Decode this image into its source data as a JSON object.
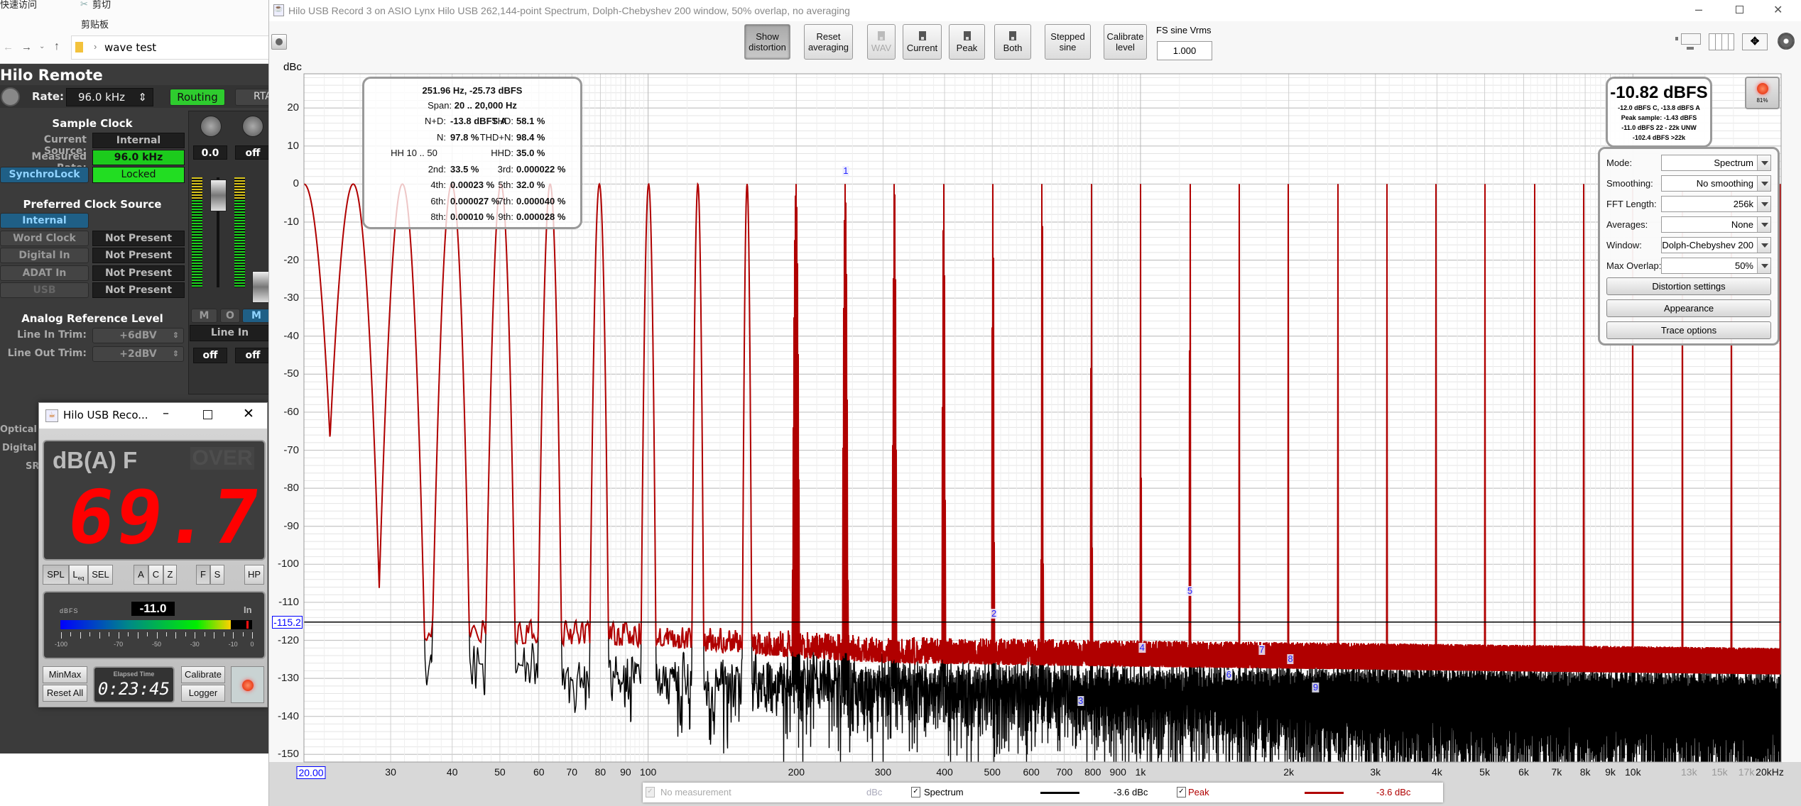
{
  "explorer": {
    "quick_access": "快速访问",
    "cut": "剪切",
    "clipboard": "剪贴板",
    "address": "wave test"
  },
  "hilo_remote": {
    "title": "Hilo Remote",
    "rate_label": "Rate:",
    "rate_value": "96.0 kHz",
    "routing": "Routing",
    "rta": "RTA",
    "sample_clock": {
      "heading": "Sample Clock",
      "current_source_label": "Current Source:",
      "current_source_value": "Internal",
      "measured_rate_label": "Measured Rate:",
      "measured_rate_value": "96.0 kHz",
      "synchrolock_label": "SynchroLock",
      "synchrolock_value": "Locked"
    },
    "preferred": {
      "heading": "Preferred Clock Source",
      "items": [
        {
          "label": "Internal",
          "value": ""
        },
        {
          "label": "Word Clock",
          "value": "Not Present"
        },
        {
          "label": "Digital In",
          "value": "Not Present"
        },
        {
          "label": "ADAT In",
          "value": "Not Present"
        },
        {
          "label": "USB",
          "value": "Not Present"
        }
      ]
    },
    "analog": {
      "heading": "Analog Reference Level",
      "line_in_label": "Line In Trim:",
      "line_in_value": "+6dBV",
      "line_out_label": "Line Out Trim:",
      "line_out_value": "+2dBV"
    },
    "mixer": {
      "ch1_value": "0.0",
      "ch2_value": "off",
      "mute1": "M",
      "solo": "O",
      "mute2": "M",
      "input": "Line In",
      "off1": "off",
      "off2": "off"
    },
    "partial_labels": [
      "Optical",
      "Digital",
      "SR"
    ]
  },
  "meter": {
    "title": "Hilo USB Reco...",
    "mode": "dB(A) F",
    "over": "OVER",
    "reading": "69.7",
    "weight_buttons": [
      "SPL",
      "L",
      "SEL"
    ],
    "leq_sub": "eq",
    "filter_buttons": [
      "A",
      "C",
      "Z"
    ],
    "speed_buttons": [
      "F",
      "S"
    ],
    "hp": "HP",
    "level_label": "dBFS",
    "level_value": "-11.0",
    "level_dbfs": -11.0,
    "peak_dbfs": -1.43,
    "channel": "In",
    "scale": [
      "-100",
      "-70",
      "-50",
      "-30",
      "-10",
      "0"
    ],
    "minmax": "MinMax",
    "reset_all": "Reset All",
    "elapsed_label": "Elapsed Time",
    "elapsed": "0:23:45",
    "calibrate": "Calibrate",
    "logger": "Logger"
  },
  "rew": {
    "title": "Hilo USB Record 3 on ASIO Lynx Hilo USB 262,144-point Spectrum, Dolph-Chebyshev 200 window, 50% overlap, no averaging",
    "toolbar": [
      {
        "id": "show-distortion",
        "l1": "Show",
        "l2": "distortion",
        "state": "pressed"
      },
      {
        "id": "reset-averaging",
        "l1": "Reset",
        "l2": "averaging",
        "state": ""
      },
      {
        "id": "wav",
        "l1": "",
        "l2": "WAV",
        "state": "dis",
        "icon": "floppy"
      },
      {
        "id": "current",
        "l1": "",
        "l2": "Current",
        "state": "",
        "icon": "floppy"
      },
      {
        "id": "peak",
        "l1": "",
        "l2": "Peak",
        "state": "",
        "icon": "floppy"
      },
      {
        "id": "both",
        "l1": "",
        "l2": "Both",
        "state": "",
        "icon": "floppy"
      },
      {
        "id": "stepped-sine",
        "l1": "Stepped",
        "l2": "sine",
        "state": ""
      },
      {
        "id": "calibrate-level",
        "l1": "Calibrate",
        "l2": "level",
        "state": ""
      }
    ],
    "fs_label": "FS sine Vrms",
    "fs_value": "1.000",
    "readout": {
      "head": "251.96 Hz, -25.73 dBFS",
      "span_label": "Span:",
      "span": "20 .. 20,000 Hz",
      "rows": [
        [
          "N+D:",
          "-13.8 dBFS A",
          "THD:",
          "58.1 %"
        ],
        [
          "N:",
          "97.8 %",
          "THD+N:",
          "98.4 %"
        ],
        [
          "HH 10 .. 50",
          "",
          "HHD:",
          "35.0 %"
        ],
        [
          "2nd:",
          "33.5 %",
          "3rd:",
          "0.000022 %"
        ],
        [
          "4th:",
          "0.00023 %",
          "5th:",
          "32.0 %"
        ],
        [
          "6th:",
          "0.000027 %",
          "7th:",
          "0.000040 %"
        ],
        [
          "8th:",
          "0.00010 %",
          "9th:",
          "0.000028 %"
        ]
      ]
    },
    "level": {
      "main": "-10.82 dBFS",
      "lines": [
        "-12.0 dBFS C, -13.8 dBFS A",
        "Peak sample: -1.43 dBFS",
        "-11.0 dBFS 22 - 22k UNW",
        "-102.4 dBFS >22k"
      ]
    },
    "record_pct": "81%",
    "settings": {
      "rows": [
        {
          "label": "Mode:",
          "value": "Spectrum"
        },
        {
          "label": "Smoothing:",
          "value": "No  smoothing"
        },
        {
          "label": "FFT Length:",
          "value": "256k"
        },
        {
          "label": "Averages:",
          "value": "None"
        },
        {
          "label": "Window:",
          "value": "Dolph-Chebyshev 200"
        },
        {
          "label": "Max Overlap:",
          "value": "50%"
        }
      ],
      "buttons": [
        "Distortion settings",
        "Appearance",
        "Trace options"
      ]
    },
    "legend": {
      "no_measurement": "No measurement",
      "no_measurement_unit": "dBc",
      "spectrum": "Spectrum",
      "spectrum_value": "-3.6 dBc",
      "peak": "Peak",
      "peak_value": "-3.6 dBc"
    }
  },
  "chart_data": {
    "type": "line",
    "ylabel": "dBc",
    "xscale": "log",
    "xlim": [
      20,
      20000
    ],
    "ylim": [
      -152,
      29
    ],
    "grid": true,
    "y_ticks": [
      20,
      10,
      0,
      -10,
      -20,
      -30,
      -40,
      -50,
      -60,
      -70,
      -80,
      -90,
      -100,
      -110,
      -120,
      -130,
      -140,
      -150
    ],
    "x_ticks": [
      {
        "f": 20,
        "label": "20.00",
        "highlight": true
      },
      {
        "f": 30,
        "label": "30"
      },
      {
        "f": 40,
        "label": "40"
      },
      {
        "f": 50,
        "label": "50"
      },
      {
        "f": 60,
        "label": "60"
      },
      {
        "f": 70,
        "label": "70"
      },
      {
        "f": 80,
        "label": "80"
      },
      {
        "f": 90,
        "label": "90"
      },
      {
        "f": 100,
        "label": "100"
      },
      {
        "f": 200,
        "label": "200"
      },
      {
        "f": 300,
        "label": "300"
      },
      {
        "f": 400,
        "label": "400"
      },
      {
        "f": 500,
        "label": "500"
      },
      {
        "f": 600,
        "label": "600"
      },
      {
        "f": 700,
        "label": "700"
      },
      {
        "f": 800,
        "label": "800"
      },
      {
        "f": 900,
        "label": "900"
      },
      {
        "f": 1000,
        "label": "1k"
      },
      {
        "f": 2000,
        "label": "2k"
      },
      {
        "f": 3000,
        "label": "3k"
      },
      {
        "f": 4000,
        "label": "4k"
      },
      {
        "f": 5000,
        "label": "5k"
      },
      {
        "f": 6000,
        "label": "6k"
      },
      {
        "f": 7000,
        "label": "7k"
      },
      {
        "f": 8000,
        "label": "8k"
      },
      {
        "f": 9000,
        "label": "9k"
      },
      {
        "f": 10000,
        "label": "10k"
      },
      {
        "f": 13000,
        "label": "13k",
        "grey": true
      },
      {
        "f": 15000,
        "label": "15k",
        "grey": true
      },
      {
        "f": 17000,
        "label": "17k",
        "grey": true
      },
      {
        "f": 20000,
        "label": "20kHz"
      }
    ],
    "cursor_level": -115.2,
    "cursor_label": "-115.2",
    "series": [
      {
        "name": "Spectrum",
        "color": "#000000",
        "peak_frequencies_per_decade": 10,
        "peak_level": 0,
        "noise_floor": [
          [
            20,
            -125
          ],
          [
            100,
            -131
          ],
          [
            1000,
            -135
          ],
          [
            20000,
            -138
          ]
        ]
      },
      {
        "name": "Peak",
        "color": "#b00000",
        "peak_frequencies_per_decade": 10,
        "peak_level": 0,
        "noise_floor": [
          [
            20,
            -117
          ],
          [
            100,
            -120
          ],
          [
            300,
            -124
          ],
          [
            1000,
            -125
          ],
          [
            20000,
            -127
          ]
        ]
      }
    ],
    "stepped_sine_start_hz": 20,
    "stepped_sine_stop_hz": 20000,
    "harmonic_markers": [
      {
        "label": "1",
        "f": 251.96,
        "db": 3.5
      },
      {
        "label": "2",
        "f": 503.9,
        "db": -113
      },
      {
        "label": "3",
        "f": 755.9,
        "db": -136
      },
      {
        "label": "4",
        "f": 1007.8,
        "db": -122
      },
      {
        "label": "5",
        "f": 1259.8,
        "db": -107
      },
      {
        "label": "6",
        "f": 1511.8,
        "db": -129
      },
      {
        "label": "7",
        "f": 1763.7,
        "db": -122.5
      },
      {
        "label": "8",
        "f": 2015.7,
        "db": -125
      },
      {
        "label": "9",
        "f": 2267.6,
        "db": -132.5
      }
    ]
  }
}
